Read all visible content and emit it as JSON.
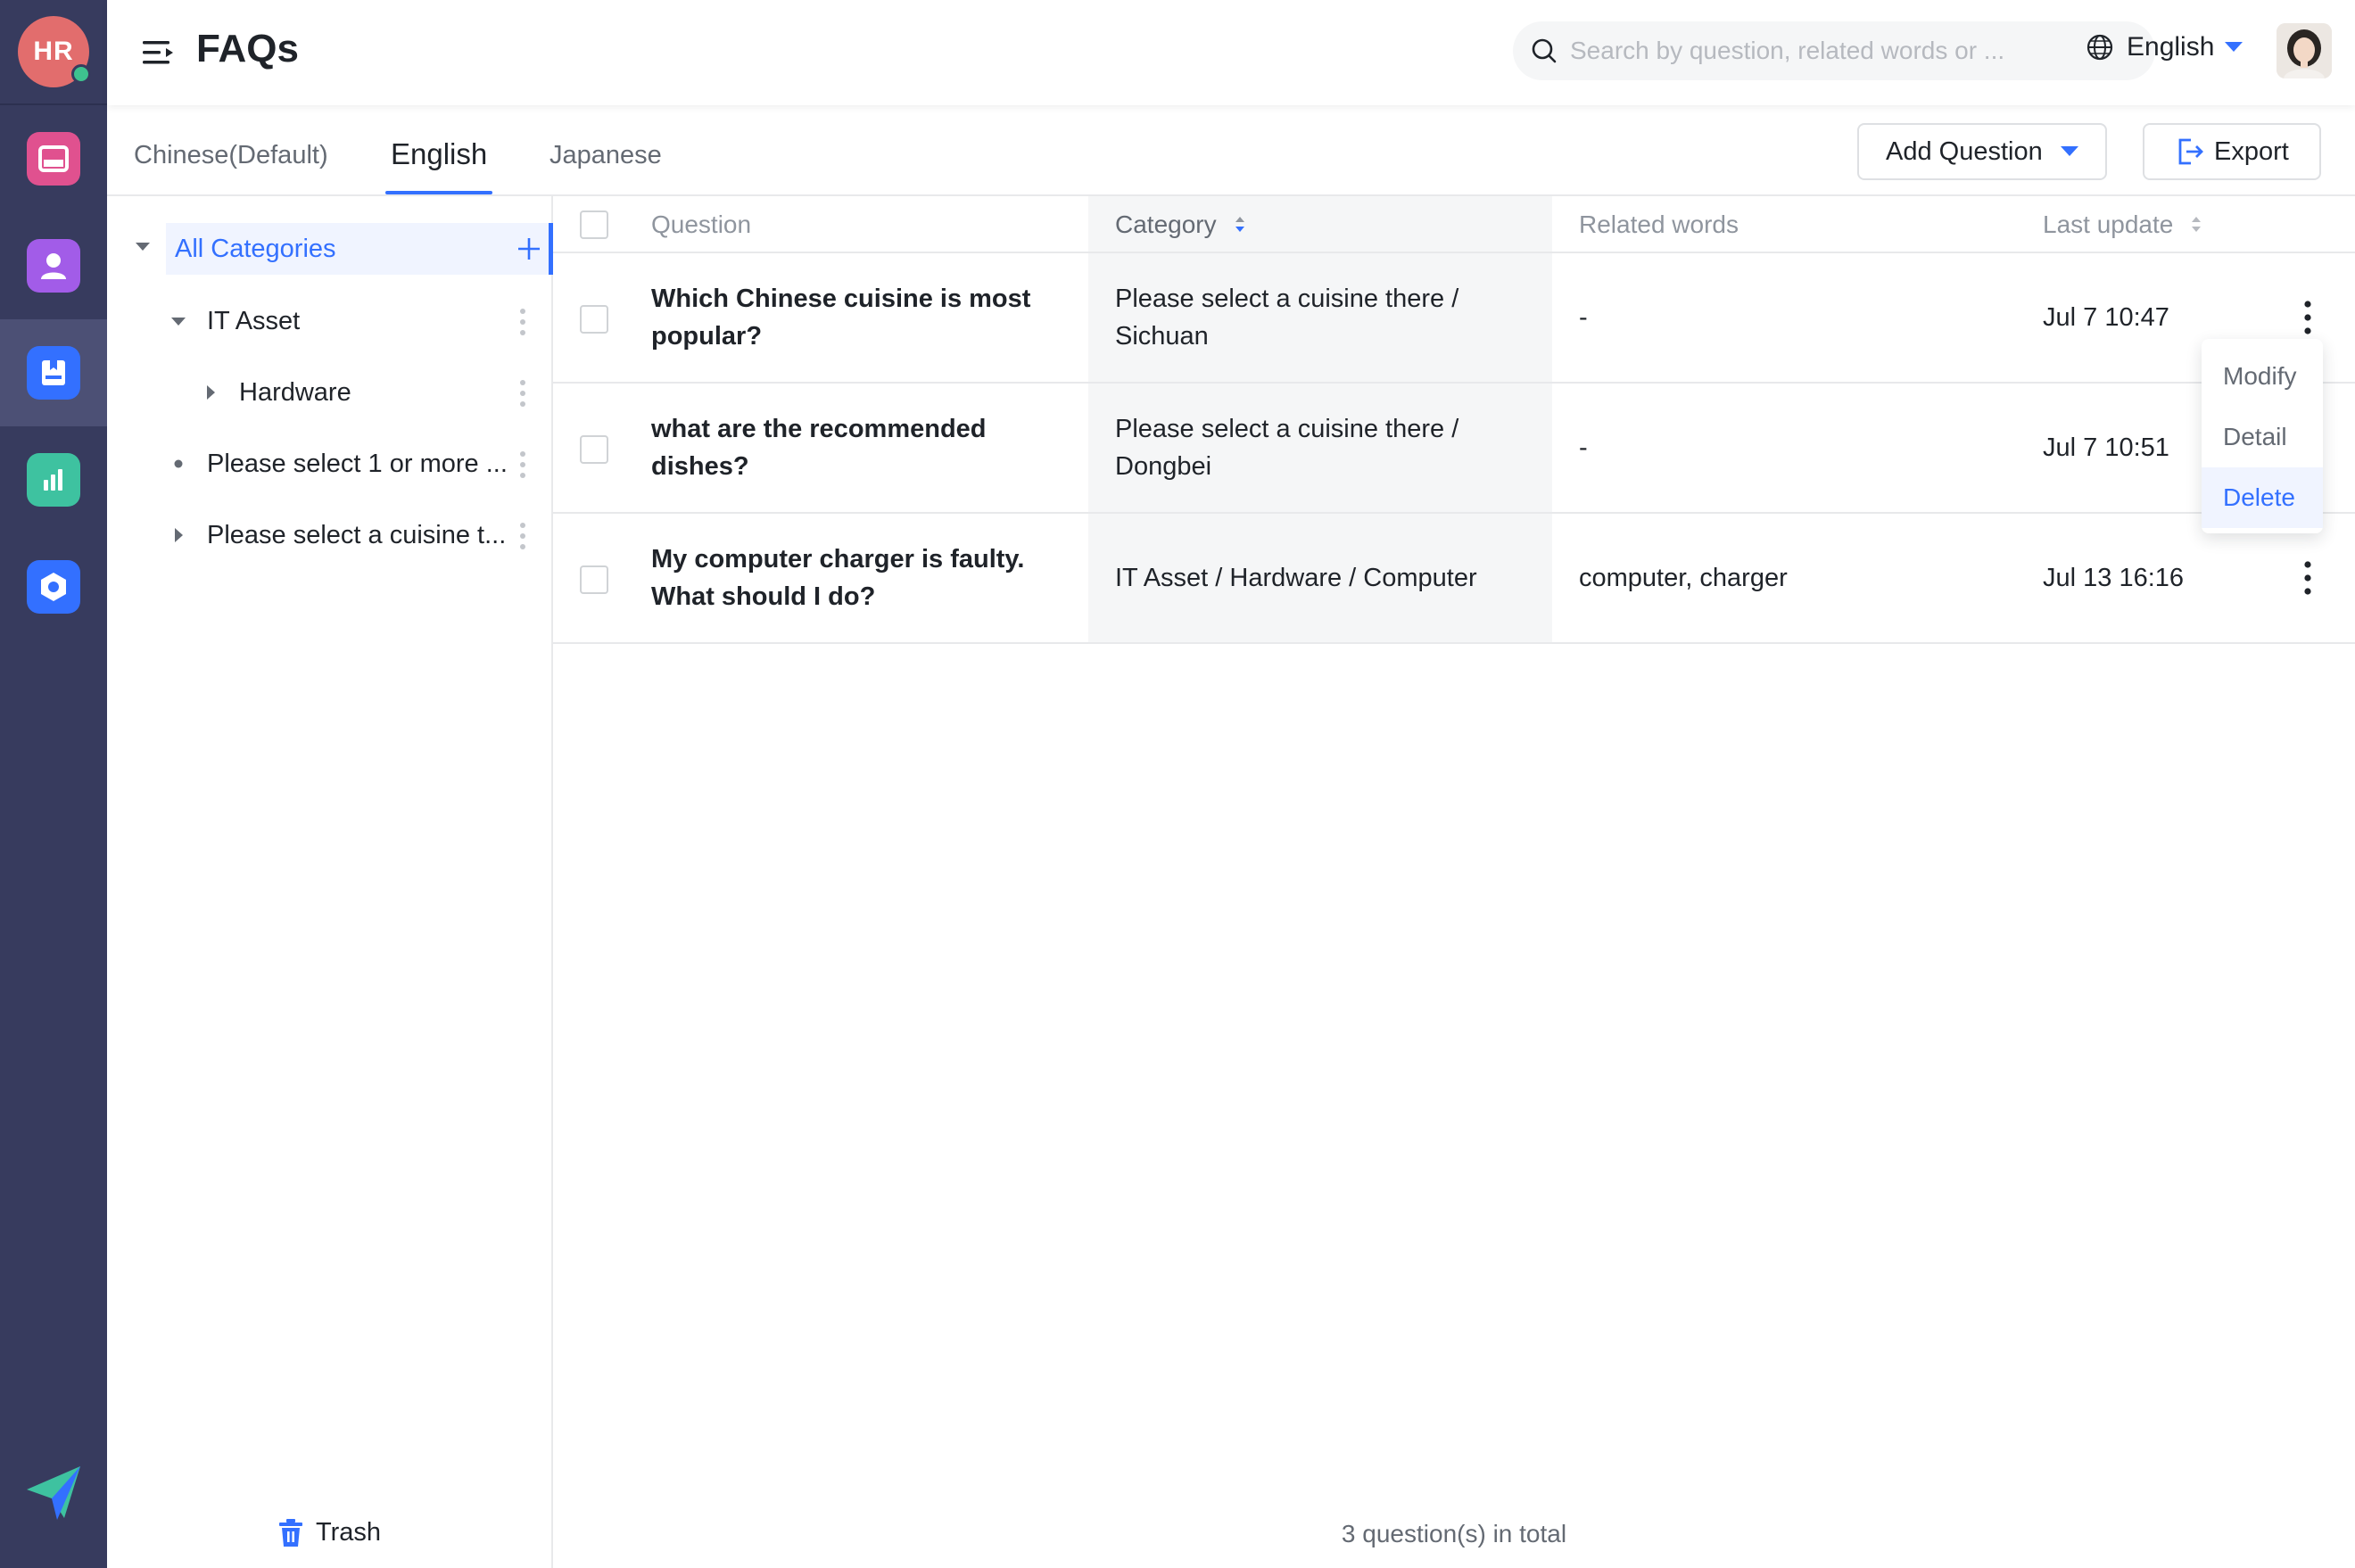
{
  "rail": {
    "brand_initials": "HR",
    "items": [
      {
        "name": "inbox",
        "color": "#e0518f"
      },
      {
        "name": "people",
        "color": "#a25ce8"
      },
      {
        "name": "knowledge",
        "color": "#3370ff",
        "active": true
      },
      {
        "name": "analytics",
        "color": "#3ec2a0"
      },
      {
        "name": "settings",
        "color": "#3370ff"
      }
    ]
  },
  "header": {
    "title": "FAQs",
    "search_placeholder": "Search by question, related words or ...",
    "language": "English"
  },
  "tabs": [
    {
      "label": "Chinese(Default)"
    },
    {
      "label": "English",
      "active": true
    },
    {
      "label": "Japanese"
    }
  ],
  "toolbar": {
    "add_question": "Add Question",
    "export": "Export"
  },
  "categories": {
    "all": "All Categories",
    "items": [
      {
        "label": "IT Asset",
        "level": 1,
        "state": "expanded"
      },
      {
        "label": "Hardware",
        "level": 2,
        "state": "collapsed"
      },
      {
        "label": "Please select 1 or more ...",
        "level": 1,
        "state": "leaf"
      },
      {
        "label": "Please select a cuisine t...",
        "level": 1,
        "state": "collapsed"
      }
    ],
    "trash": "Trash"
  },
  "table": {
    "columns": {
      "question": "Question",
      "category": "Category",
      "related": "Related words",
      "updated": "Last update"
    },
    "rows": [
      {
        "question": "Which Chinese cuisine is most popular?",
        "category": "Please select a cuisine there / Sichuan",
        "related": "-",
        "updated": "Jul 7 10:47"
      },
      {
        "question": "what are the recommended dishes?",
        "category": "Please select a cuisine there / Dongbei",
        "related": "-",
        "updated": "Jul 7 10:51"
      },
      {
        "question": "My computer charger is faulty. What should I do?",
        "category": "IT Asset / Hardware / Computer",
        "related": "computer, charger",
        "updated": "Jul 13 16:16"
      }
    ],
    "total": "3 question(s) in total"
  },
  "menu": {
    "modify": "Modify",
    "detail": "Detail",
    "delete": "Delete"
  },
  "colors": {
    "accent": "#3370ff",
    "rail_bg": "#373b5e"
  }
}
